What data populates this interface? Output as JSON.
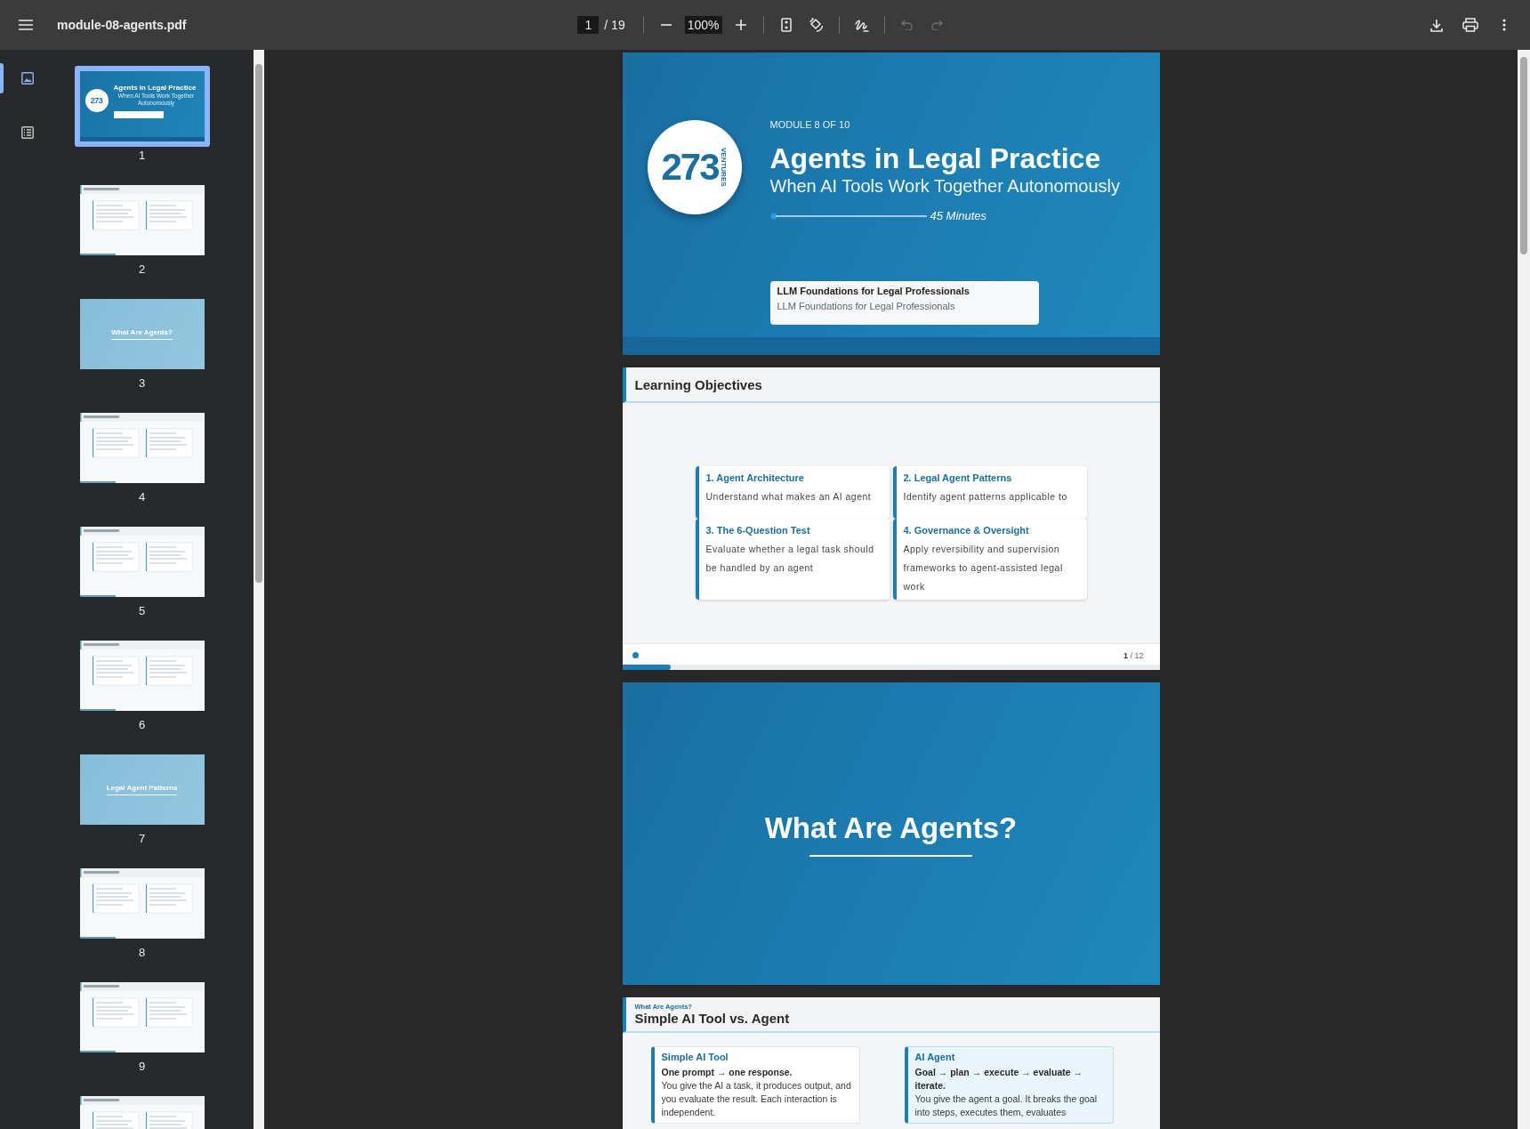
{
  "toolbar": {
    "file_name": "module-08-agents.pdf",
    "page": {
      "value": "1",
      "total": "/ 19"
    },
    "zoom": {
      "value": "100%"
    },
    "undo": {
      "disabled": true
    },
    "redo": {
      "disabled": true
    }
  },
  "sidebar": {
    "views": [
      {
        "kind": "thumbnails",
        "selected": true
      },
      {
        "kind": "outline",
        "selected": false
      }
    ],
    "thumbnails": [
      {
        "kind": "cover",
        "page": "1",
        "selected": true,
        "logo": "273",
        "title": "Agents in Legal Practice",
        "subtitle": "When AI Tools Work Together Autonomously"
      },
      {
        "kind": "content",
        "page": "2",
        "selected": false
      },
      {
        "kind": "section",
        "page": "3",
        "selected": false,
        "title": "What Are Agents?"
      },
      {
        "kind": "content",
        "page": "4",
        "selected": false
      },
      {
        "kind": "content",
        "page": "5",
        "selected": false
      },
      {
        "kind": "content",
        "page": "6",
        "selected": false
      },
      {
        "kind": "section",
        "page": "7",
        "selected": false,
        "title": "Legal Agent Patterns"
      },
      {
        "kind": "content",
        "page": "8",
        "selected": false
      },
      {
        "kind": "content",
        "page": "9",
        "selected": false
      },
      {
        "kind": "content",
        "selected": false
      }
    ]
  },
  "pages": [
    {
      "kind": "cover",
      "logo": "273",
      "logo_caption": "VENTURES",
      "eyebrow": "MODULE 8 OF 10",
      "title": "Agents in Legal Practice",
      "subtitle": "When AI Tools Work Together Autonomously",
      "duration": "45 Minutes",
      "course_box": {
        "title": "LLM Foundations for Legal Professionals",
        "subtitle": "LLM Foundations for Legal Professionals"
      }
    },
    {
      "kind": "objectives",
      "title": "Learning Objectives",
      "cards": [
        {
          "title": "1. Agent Architecture",
          "text": "Understand what makes an AI agent"
        },
        {
          "title": "2. Legal Agent Patterns",
          "text": "Identify agent patterns applicable to"
        },
        {
          "title": "3. The 6-Question Test",
          "text": "Evaluate whether a legal task should be handled by an agent"
        },
        {
          "title": "4. Governance & Oversight",
          "text": "Apply reversibility and supervision frameworks to agent-assisted legal work"
        }
      ],
      "footer": {
        "counter": "**1** / 12",
        "level": 0.09
      }
    },
    {
      "kind": "section",
      "title": "What Are Agents?"
    },
    {
      "kind": "comparison",
      "eyebrow": "What Are Agents?",
      "title": "Simple AI Tool vs. Agent",
      "cards": [
        {
          "kind": "plain",
          "title": "Simple AI Tool",
          "lead": "**One prompt** → **one response.**",
          "text": "You give the AI a task, it produces output, and you evaluate the result. Each interaction is independent."
        },
        {
          "kind": "highlight",
          "title": "AI Agent",
          "lead": "**Goal** → **plan** → **execute** → **evaluate** → **iterate.**",
          "text": "You give the agent a goal.  It breaks the goal into steps, executes them, evaluates"
        }
      ]
    }
  ]
}
